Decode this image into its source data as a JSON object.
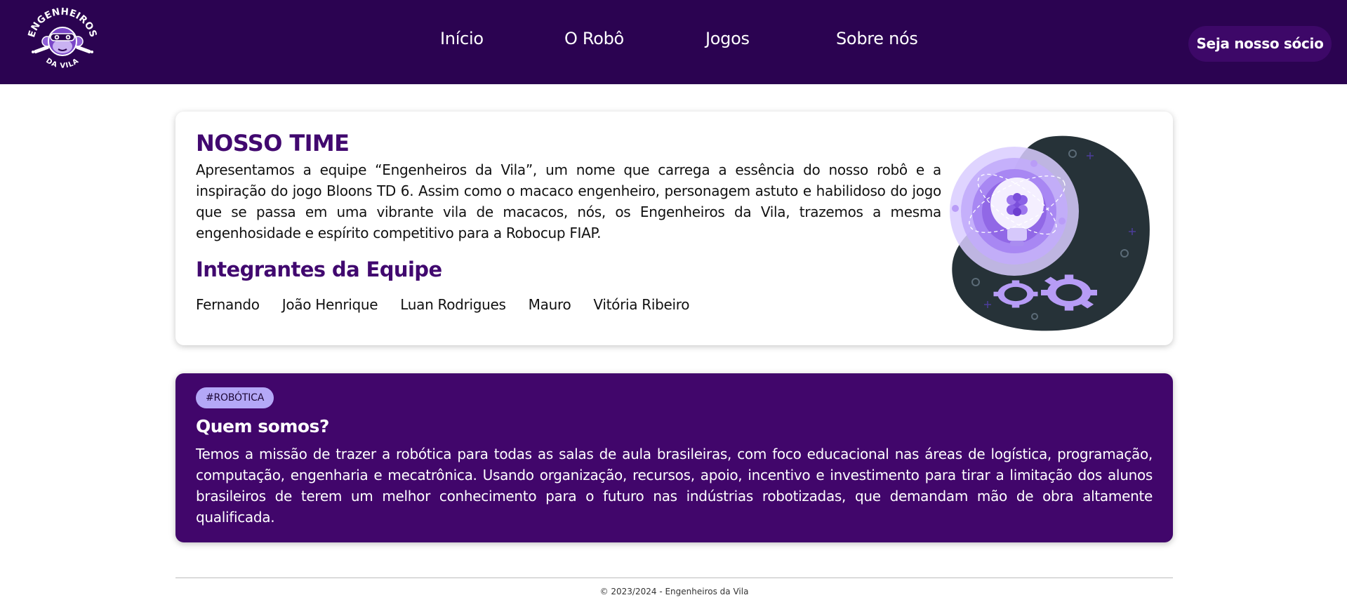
{
  "header": {
    "logo": {
      "icon": "monkey-engineer-logo",
      "line1": "ENGENHEIROS",
      "line2": "DA VILA"
    },
    "nav": [
      {
        "label": "Início"
      },
      {
        "label": "O Robô"
      },
      {
        "label": "Jogos"
      },
      {
        "label": "Sobre nós"
      }
    ],
    "cta_label": "Seja nosso sócio"
  },
  "team": {
    "title": "NOSSO TIME",
    "description": "Apresentamos a equipe “Engenheiros da Vila”, um nome que carrega a essência do nosso robô e a inspiração do jogo Bloons TD 6. Assim como o macaco engenheiro, personagem astuto e habilidoso do jogo que se passa em uma vibrante vila de macacos, nós, os Engenheiros da Vila, trazemos a mesma engenhosidade e espírito competitivo para a Robocup FIAP.",
    "members_title": "Integrantes da Equipe",
    "members": [
      "Fernando",
      "João Henrique",
      "Luan Rodrigues",
      "Mauro",
      "Vitória Ribeiro"
    ],
    "illustration": "lightbulb-gears-illustration"
  },
  "about": {
    "tag": "#ROBÓTICA",
    "title": "Quem somos?",
    "text": "Temos a missão de trazer a robótica para todas as salas de aula brasileiras, com foco educacional nas áreas de logística, programação, computação, engenharia e mecatrônica. Usando organização, recursos, apoio, incentivo e investimento para tirar a limitação dos alunos brasileiros de terem um melhor conhecimento para o futuro nas indústrias robotizadas, que demandam mão de obra altamente qualificada."
  },
  "footer": {
    "text": "© 2023/2024 - Engenheiros da Vila"
  },
  "colors": {
    "header_bg": "#2b0351",
    "brand_purple": "#41086f",
    "about_bg": "#41066b",
    "tag_bg": "#b4a8f7",
    "illustration_dark": "#263238"
  }
}
